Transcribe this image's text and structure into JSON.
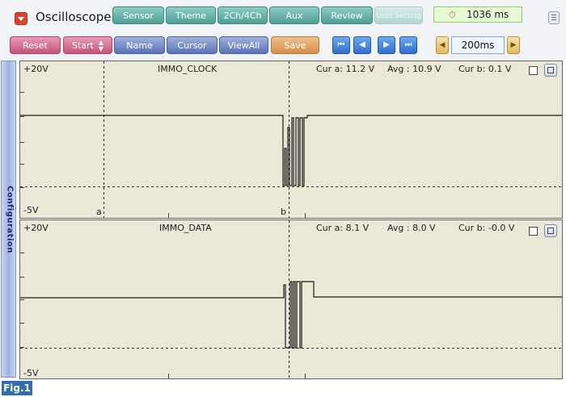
{
  "toolbar": {
    "title": "Oscilloscope",
    "top_buttons": [
      "Sensor",
      "Theme",
      "2Ch/4Ch",
      "Aux",
      "Review",
      "User Setting"
    ],
    "reset_label": "Reset",
    "start_label": "Start",
    "name_label": "Name",
    "cursor_label": "Cursor",
    "viewall_label": "ViewAll",
    "save_label": "Save",
    "elapsed": "1036 ms",
    "timebase": "200ms"
  },
  "sidebar": {
    "label": "Configuration"
  },
  "channels": [
    {
      "name": "IMMO_CLOCK",
      "top_label": "+20V",
      "bottom_label": "-5V",
      "cur_a": "Cur a: 11.2 V",
      "avg": "Avg  : 10.9 V",
      "cur_b": "Cur b: 0.1 V",
      "cursor_a": "a",
      "cursor_b": "b"
    },
    {
      "name": "IMMO_DATA",
      "top_label": "+20V",
      "bottom_label": "-5V",
      "cur_a": "Cur a: 8.1 V",
      "avg": "Avg  : 8.0 V",
      "cur_b": "Cur b: -0.0 V"
    }
  ],
  "figure_label": "Fig.1",
  "colors": {
    "plot_bg": "#eae8d6",
    "trace": "#1a1a1a",
    "accent_teal": "#4f9f98",
    "accent_pink": "#c4547a",
    "accent_blue": "#5a73b8",
    "accent_orange": "#d48f49"
  }
}
